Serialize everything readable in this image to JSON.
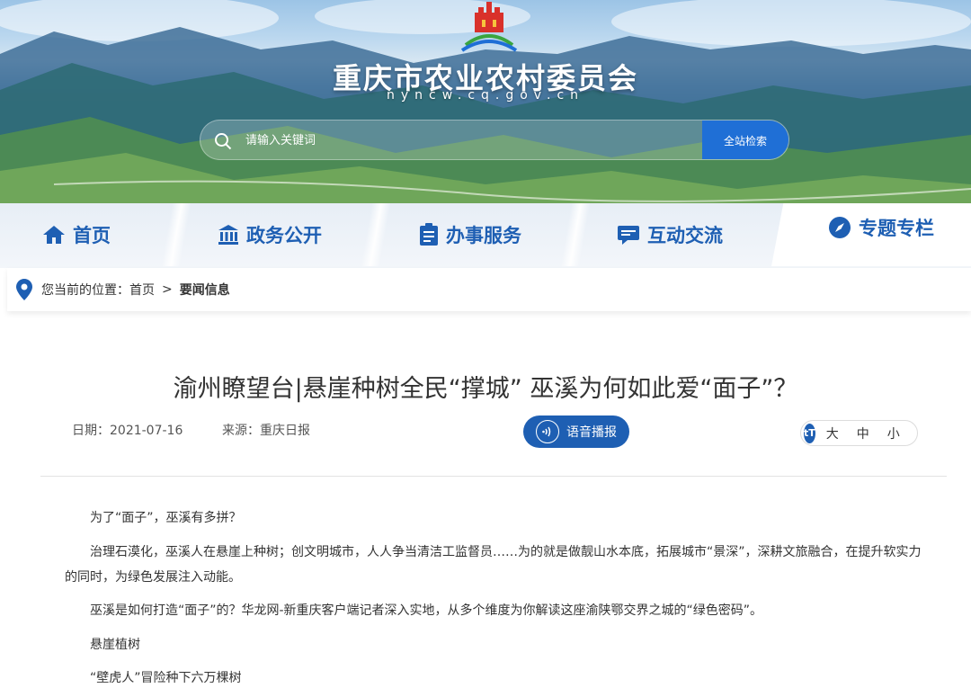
{
  "site": {
    "title": "重庆市农业农村委员会",
    "url": "nyncw.cq.gov.cn"
  },
  "search": {
    "placeholder": "请输入关键词",
    "button_label": "全站检索"
  },
  "nav": {
    "items": [
      {
        "label": "首页",
        "icon": "home-icon"
      },
      {
        "label": "政务公开",
        "icon": "building-icon"
      },
      {
        "label": "办事服务",
        "icon": "clipboard-icon"
      },
      {
        "label": "互动交流",
        "icon": "chat-icon"
      },
      {
        "label": "专题专栏",
        "icon": "compass-icon",
        "active": true
      }
    ]
  },
  "breadcrumb": {
    "prefix": "您当前的位置：",
    "home": "首页",
    "separator": ">",
    "current": "要闻信息"
  },
  "article": {
    "title": "渝州瞭望台|悬崖种树全民“撑城” 巫溪为何如此爱“面子”？",
    "date": "日期：2021-07-16",
    "source": "来源：重庆日报",
    "audio_label": "语音播报",
    "font_size": {
      "icon": "tT",
      "large": "大",
      "medium": "中",
      "small": "小"
    },
    "paragraphs": [
      "为了“面子”，巫溪有多拼？",
      "治理石漠化，巫溪人在悬崖上种树；创文明城市，人人争当清洁工监督员……为的就是做靓山水本底，拓展城市“景深”，深耕文旅融合，在提升软实力的同时，为绿色发展注入动能。",
      "巫溪是如何打造“面子”的？华龙网-新重庆客户端记者深入实地，从多个维度为你解读这座渝陕鄂交界之城的“绿色密码”。",
      "悬崖植树",
      "“壁虎人”冒险种下六万棵树"
    ]
  },
  "colors": {
    "primary": "#1e5fb3",
    "search_button": "#1f6fd6"
  }
}
